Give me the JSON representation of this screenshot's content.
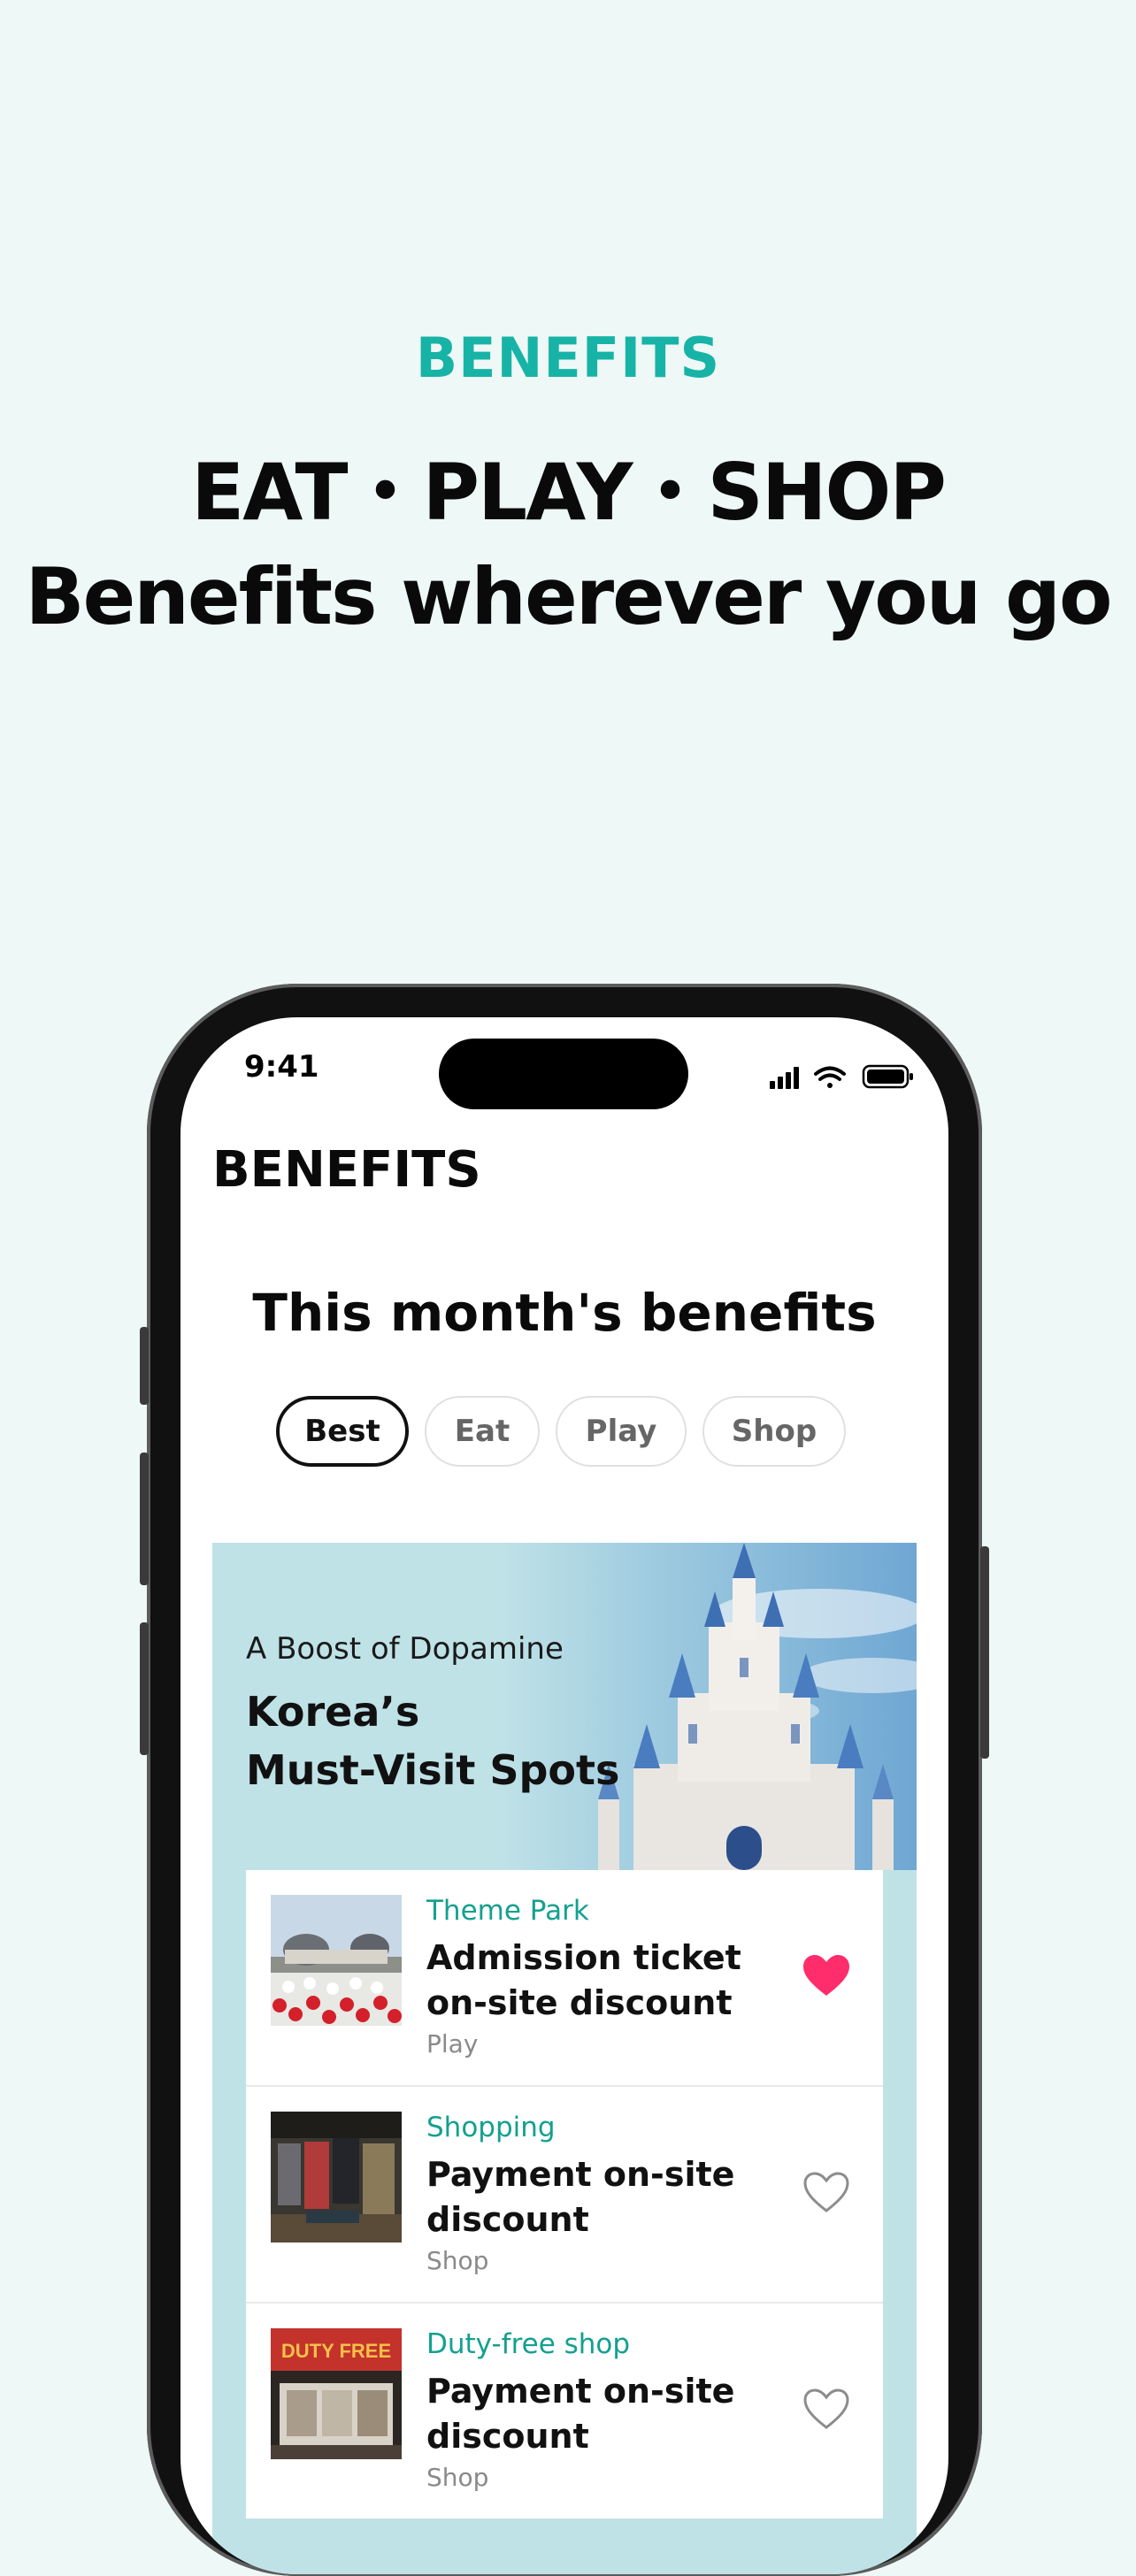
{
  "hero": {
    "eyebrow": "BENEFITS",
    "line1": "EAT・PLAY・SHOP",
    "line2": "Benefits wherever you go"
  },
  "status_bar": {
    "time": "9:41"
  },
  "app": {
    "title": "BENEFITS",
    "section_title": "This month's benefits",
    "tabs": [
      {
        "label": "Best",
        "active": true
      },
      {
        "label": "Eat",
        "active": false
      },
      {
        "label": "Play",
        "active": false
      },
      {
        "label": "Shop",
        "active": false
      }
    ]
  },
  "banner": {
    "subtitle": "A Boost of Dopamine",
    "title_line1": "Korea’s",
    "title_line2": "Must-Visit Spots"
  },
  "cards": [
    {
      "category": "Theme Park",
      "title": "Admission ticket on-site discount",
      "tag": "Play",
      "liked": true
    },
    {
      "category": "Shopping",
      "title": "Payment on-site discount",
      "tag": "Shop",
      "liked": false
    },
    {
      "category": "Duty-free shop",
      "title": "Payment on-site discount",
      "tag": "Shop",
      "liked": false,
      "thumb_label": "DUTY FREE"
    }
  ],
  "colors": {
    "accent": "#17b3a6",
    "category": "#14a08f",
    "heart_active": "#ff2d6b",
    "background": "#eef8f6"
  }
}
